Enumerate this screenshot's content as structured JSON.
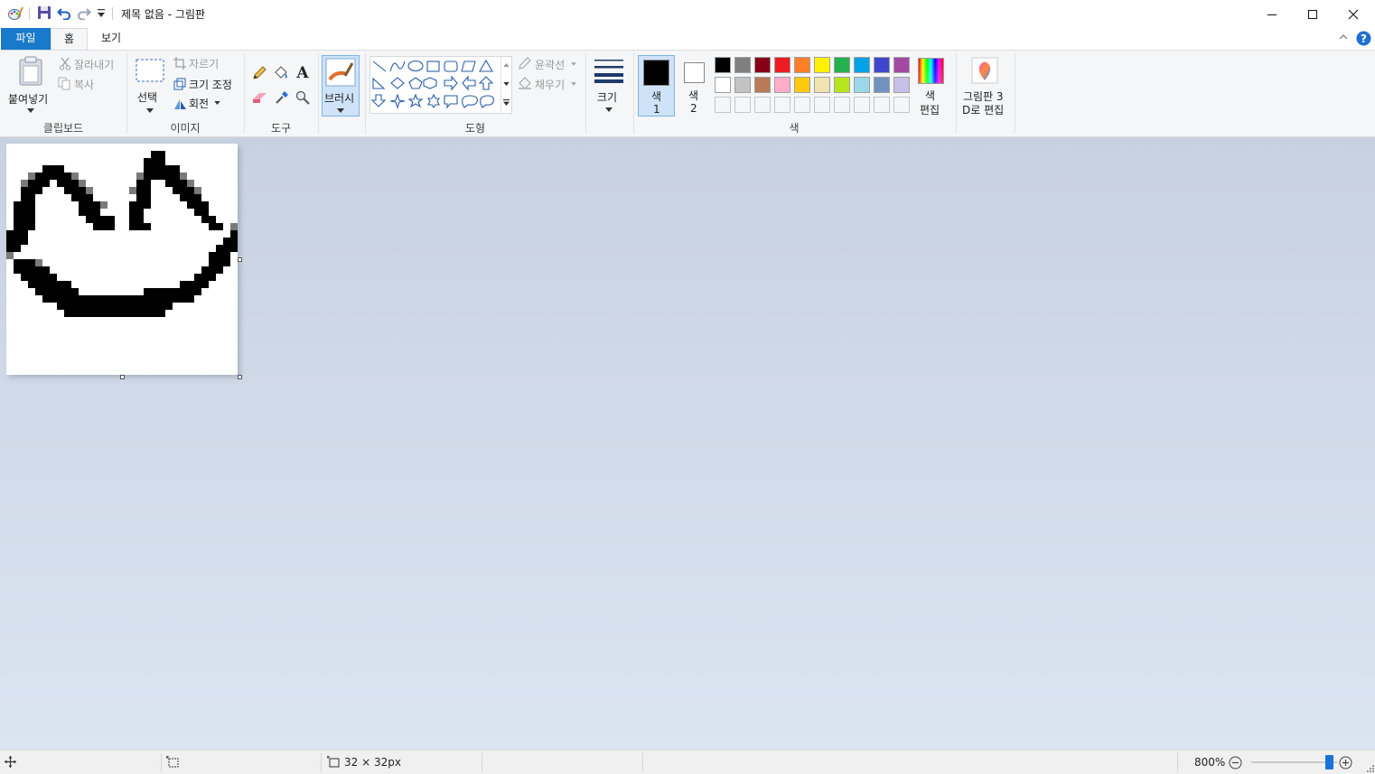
{
  "window": {
    "title": "제목 없음 - 그림판",
    "controls": {
      "minimize": "minimize-icon",
      "maximize": "maximize-icon",
      "close": "close-icon"
    }
  },
  "quick_access": [
    "paint-app-icon",
    "save-icon",
    "undo-icon",
    "redo-icon",
    "customize-dropdown-icon"
  ],
  "tabs": [
    {
      "label": "파일",
      "selected": false
    },
    {
      "label": "홈",
      "selected": true
    },
    {
      "label": "보기",
      "selected": false
    }
  ],
  "ribbon": {
    "clipboard": {
      "group": "클립보드",
      "paste": "붙여넣기",
      "cut": "잘라내기",
      "copy": "복사"
    },
    "image": {
      "group": "이미지",
      "select": "선택",
      "crop": "자르기",
      "resize": "크기 조정",
      "rotate": "회전"
    },
    "tools": {
      "group": "도구"
    },
    "brushes": {
      "label": "브러시"
    },
    "shapes": {
      "group": "도형",
      "outline": "윤곽선",
      "fill": "채우기"
    },
    "size": {
      "label": "크기"
    },
    "colors": {
      "group": "색",
      "color1": {
        "label_a": "색",
        "label_b": "1",
        "value": "#000000"
      },
      "color2": {
        "label_a": "색",
        "label_b": "2",
        "value": "#ffffff"
      },
      "edit_a": "색",
      "edit_b": "편집",
      "palette_row1": [
        "#000000",
        "#7f7f7f",
        "#880015",
        "#ed1c24",
        "#ff7f27",
        "#fff200",
        "#22b14c",
        "#00a2e8",
        "#3f48cc",
        "#a349a4"
      ],
      "palette_row2": [
        "#ffffff",
        "#c3c3c3",
        "#b97a57",
        "#ffaec9",
        "#ffc90e",
        "#efe4b0",
        "#b5e61d",
        "#99d9ea",
        "#7092be",
        "#c8bfe7"
      ]
    },
    "paint3d": {
      "line1": "그림판 3",
      "line2": "D로 편집"
    }
  },
  "statusbar": {
    "image_size": "32 × 32px",
    "zoom": "800%",
    "zoom_level": 0.9
  }
}
